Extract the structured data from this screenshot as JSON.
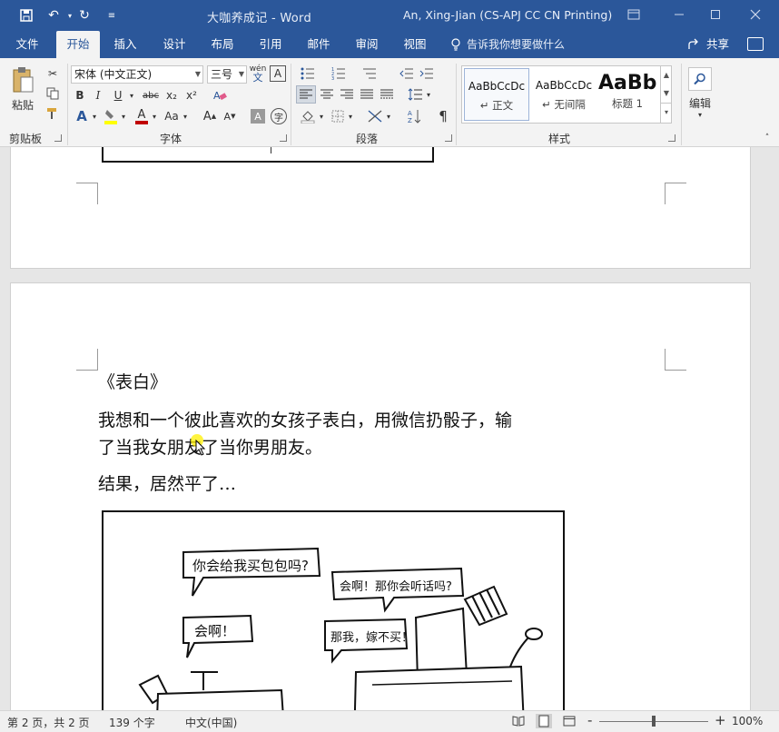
{
  "window": {
    "doc_title": "大咖养成记",
    "app_name": "Word",
    "title_separator": "-",
    "user": "An, Xing-Jian (CS-APJ CC CN Printing)"
  },
  "tabs": [
    "文件",
    "开始",
    "插入",
    "设计",
    "布局",
    "引用",
    "邮件",
    "审阅",
    "视图"
  ],
  "active_tab": "开始",
  "tell_me": "告诉我你想要做什么",
  "share": "共享",
  "ribbon": {
    "clipboard": {
      "paste": "粘贴",
      "label": "剪贴板"
    },
    "font": {
      "name": "宋体 (中文正文)",
      "size": "三号",
      "label": "字体",
      "bold": "B",
      "italic": "I",
      "underline": "U",
      "strike": "abc",
      "sub": "x₂",
      "sup": "x²",
      "case": "Aa",
      "grow": "A",
      "shrink": "A",
      "wen": "wén"
    },
    "paragraph": {
      "label": "段落"
    },
    "styles": {
      "label": "样式",
      "items": [
        {
          "sample": "AaBbCcDc",
          "name": "↵ 正文"
        },
        {
          "sample": "AaBbCcDc",
          "name": "↵ 无间隔"
        },
        {
          "sample": "AaBb",
          "name": "标题 1"
        }
      ]
    },
    "editing": {
      "label": "编辑"
    }
  },
  "document": {
    "title": "《表白》",
    "paragraph1_line1": "我想和一个彼此喜欢的女孩子表白，用微信扔骰子，输",
    "paragraph1_line2": "了当我女朋友了当你男朋友。",
    "paragraph2": "结果，居然平了…",
    "comic_bubbles": [
      "你会给我买包包吗?",
      "会啊！那你会听话吗?",
      "会啊！",
      "那我，嫁不买！"
    ]
  },
  "statusbar": {
    "page": "第 2 页，共 2 页",
    "words": "139 个字",
    "language": "中文(中国)",
    "zoom": "100%",
    "zoom_minus": "-",
    "zoom_plus": "+",
    "zoom_level": 0.5
  },
  "colors": {
    "brand": "#2b579a",
    "ribbon": "#f3f3f3",
    "canvas": "#e6e6e6",
    "font_color": "#c00000",
    "highlight": "#ffff00"
  }
}
